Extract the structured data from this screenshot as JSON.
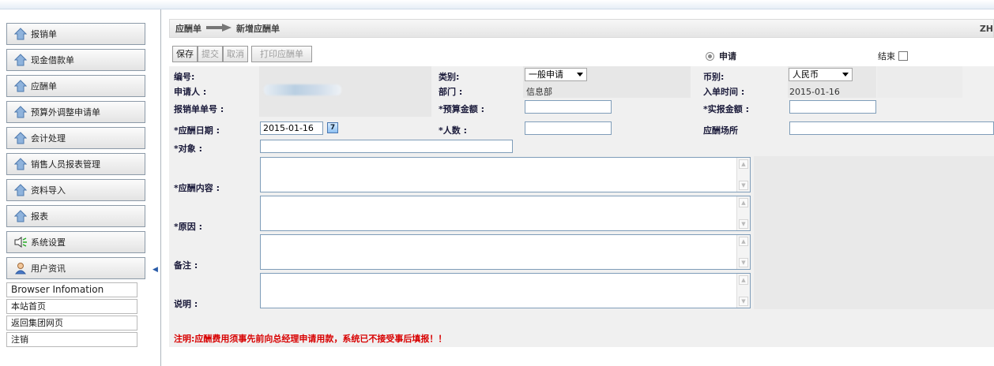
{
  "sidebar": {
    "menu": [
      {
        "label": "报销单",
        "icon": "house-icon"
      },
      {
        "label": "现金借款单",
        "icon": "house-icon"
      },
      {
        "label": "应酬单",
        "icon": "house-icon"
      },
      {
        "label": "预算外调整申请单",
        "icon": "house-icon"
      },
      {
        "label": "会计处理",
        "icon": "house-icon"
      },
      {
        "label": "销售人员报表管理",
        "icon": "house-icon"
      },
      {
        "label": "资料导入",
        "icon": "house-icon"
      },
      {
        "label": "报表",
        "icon": "house-icon"
      },
      {
        "label": "系统设置",
        "icon": "speaker-icon"
      },
      {
        "label": "用户资讯",
        "icon": "user-icon"
      }
    ],
    "info_title": "Browser Infomation",
    "links": [
      "本站首页",
      "返回集团网页",
      "注销"
    ]
  },
  "breadcrumb": {
    "parent": "应酬单",
    "current": "新增应酬单",
    "right_text": "ZH"
  },
  "toolbar": {
    "save": "保存",
    "submit": "提交",
    "cancel": "取消",
    "print": "打印应酬单"
  },
  "status": {
    "apply_label": "申请",
    "end_label": "结束"
  },
  "form": {
    "number_label": "编号:",
    "category_label": "类别:",
    "category_value": "一般申请",
    "currency_label": "币别:",
    "currency_value": "人民币",
    "applicant_label": "申请人 :",
    "dept_label": "部门 :",
    "dept_value": "信息部",
    "entry_time_label": "入单时间 :",
    "entry_time_value": "2015-01-16",
    "reimb_no_label": "报销单单号 :",
    "budget_label": "*预算金额 :",
    "actual_label": "*实报金额 :",
    "date_label": "*应酬日期 :",
    "date_value": "2015-01-16",
    "people_label": "*人数 :",
    "venue_label": "应酬场所",
    "target_label": "*对象 :",
    "content_label": "*应酬内容 :",
    "reason_label": "*原因 :",
    "remarks_label": "备注 :",
    "explain_label": "说明 :"
  },
  "note": "注明:应酬费用须事先前向总经理申请用款，系统已不接受事后填报！！",
  "colors": {
    "note": "#d80000",
    "accent": "#4a77b0"
  }
}
